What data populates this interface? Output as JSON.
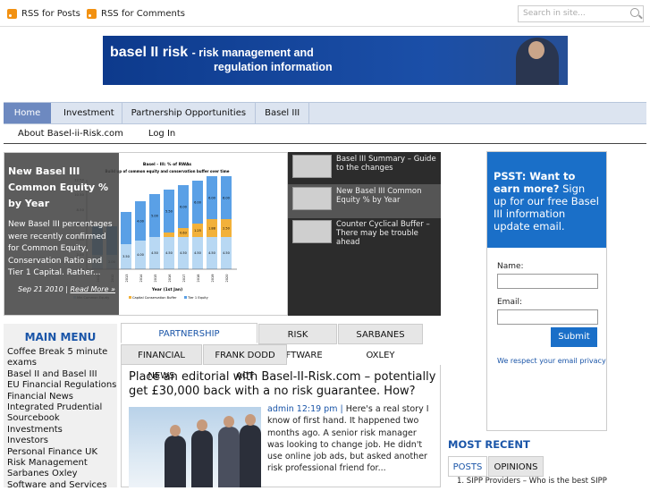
{
  "header": {
    "rss_posts": "RSS for Posts",
    "rss_comments": "RSS for Comments",
    "search_placeholder": "Search in site..."
  },
  "banner": {
    "title": "basel II risk",
    "tagline_1": "- risk management and",
    "tagline_2": "regulation information"
  },
  "nav": {
    "primary": [
      "Home",
      "Investment",
      "Partnership Opportunities",
      "Basel III"
    ],
    "secondary": [
      "About Basel-ii-Risk.com",
      "Log In"
    ]
  },
  "featured": {
    "title": "New Basel III Common Equity % by Year",
    "desc": "New Basel III percentages were recently confirmed for Common Equity, Conservation Ratio and Tier 1 Capital. Rather...",
    "date": "Sep 21 2010 |",
    "more": "Read More »",
    "chart_title": "Basel - III: % of RWAs",
    "chart_subtitle": "Build up of common equity and conservation buffer over time",
    "chart_xlabel": "Year (1st Jan)"
  },
  "chart_data": {
    "type": "bar",
    "title": "Basel - III: % of RWAs",
    "subtitle": "Build up of common equity and conservation buffer over time",
    "xlabel": "Year (1st Jan)",
    "categories": [
      "2011",
      "2012",
      "2013",
      "2014",
      "2015",
      "2016",
      "2017",
      "2018",
      "2019",
      "2020"
    ],
    "series": [
      {
        "name": "Min Common Equity",
        "values": [
          2.0,
          2.0,
          3.5,
          4.0,
          4.5,
          4.5,
          4.5,
          4.5,
          4.5,
          4.5
        ]
      },
      {
        "name": "Capital Conservation Buffer",
        "values": [
          0,
          0,
          0,
          0,
          0,
          0.625,
          1.25,
          1.875,
          2.5,
          2.5
        ]
      },
      {
        "name": "Tier 1 Equity",
        "values": [
          4.0,
          4.0,
          4.5,
          5.5,
          6.0,
          6.0,
          6.0,
          6.0,
          6.0,
          6.0
        ]
      }
    ],
    "value_labels": [
      "2.00",
      "2.00",
      "3.50",
      "4.00",
      "4.50",
      "4.50",
      "4.50",
      "4.50",
      "4.50",
      "4.50"
    ],
    "buffer_labels": [
      "0.63",
      "1.25",
      "1.88",
      "2.50"
    ],
    "tier_labels": [
      "4.00",
      "5.00",
      "5.50",
      "6.00",
      "6.00",
      "6.00",
      "6.00"
    ],
    "yticks": [
      "12.50",
      "10.50",
      "8.50",
      "6.50",
      "4.50",
      "2.50",
      "0.50"
    ],
    "ylim": [
      0,
      12.5
    ],
    "legend": [
      "Min Common Equity",
      "Capital Conservation Buffer",
      "Tier 1 Equity"
    ],
    "colors": {
      "tier": "#5aa0e6",
      "buffer": "#f2b13a",
      "common": "#b8d8f3"
    }
  },
  "slider": [
    {
      "label": "Basel III Summary – Guide to the changes"
    },
    {
      "label": "New Basel III Common Equity % by Year"
    },
    {
      "label": "Counter Cyclical Buffer – There may be trouble ahead"
    }
  ],
  "promo": {
    "headline_bold": "PSST: Want to earn more?",
    "headline_rest": " Sign up for our free Basel III information update email.",
    "name_label": "Name:",
    "email_label": "Email:",
    "submit": "Submit",
    "privacy": "We respect your email privacy"
  },
  "main_menu": {
    "heading": "MAIN MENU",
    "items": [
      "Coffee Break 5 minute exams",
      "Basel II and Basel III",
      "EU Financial Regulations",
      "Financial News",
      "Integrated Prudential Sourcebook",
      "Investments",
      "Investors",
      "Personal Finance UK",
      "Risk Management",
      "Sarbanes Oxley",
      "Software and Services"
    ]
  },
  "tabs": {
    "row1": [
      "PARTNERSHIP OPPORTUNITIES",
      "RISK SOFTWARE",
      "SARBANES OXLEY"
    ],
    "row2": [
      "FINANCIAL NEWS",
      "FRANK DODD ACT"
    ]
  },
  "post": {
    "title": "Place an editorial with Basel-II-Risk.com – potentially get £30,000 back with a no risk guarantee. How?",
    "meta": "admin 12:19 pm |",
    "body": " Here's a real story I know of first hand. It happened two months ago. A senior risk manager was looking to change job. He didn't use online job ads, but asked another risk professional friend for..."
  },
  "right": {
    "most_recent": "MOST RECENT",
    "tabs": [
      "POSTS",
      "OPINIONS"
    ],
    "first_item": "1.  SIPP Providers – Who is the best SIPP"
  }
}
